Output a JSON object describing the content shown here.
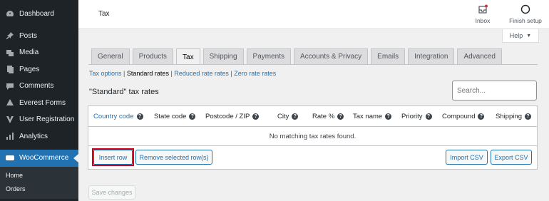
{
  "sidebar": {
    "items": [
      {
        "label": "Dashboard",
        "icon": "dashboard-icon"
      },
      {
        "label": "Posts",
        "icon": "pin-icon"
      },
      {
        "label": "Media",
        "icon": "media-icon"
      },
      {
        "label": "Pages",
        "icon": "pages-icon"
      },
      {
        "label": "Comments",
        "icon": "comment-icon"
      },
      {
        "label": "Everest Forms",
        "icon": "forms-icon"
      },
      {
        "label": "User Registration",
        "icon": "user-registration-icon"
      },
      {
        "label": "Analytics",
        "icon": "analytics-icon"
      }
    ],
    "active": {
      "label": "WooCommerce",
      "icon": "woocommerce-icon"
    },
    "submenu": [
      "Home",
      "Orders"
    ]
  },
  "header": {
    "title": "Tax",
    "inbox_label": "Inbox",
    "finish_label": "Finish setup",
    "help_label": "Help"
  },
  "tabs": [
    "General",
    "Products",
    "Tax",
    "Shipping",
    "Payments",
    "Accounts & Privacy",
    "Emails",
    "Integration",
    "Advanced"
  ],
  "active_tab": "Tax",
  "sublinks": {
    "tax_options": "Tax options",
    "standard_rates": "Standard rates",
    "reduced_rates": "Reduced rate rates",
    "zero_rates": "Zero rate rates"
  },
  "section_title": "\"Standard\" tax rates",
  "search": {
    "placeholder": "Search..."
  },
  "table": {
    "columns": [
      "Country code",
      "State code",
      "Postcode / ZIP",
      "City",
      "Rate %",
      "Tax name",
      "Priority",
      "Compound",
      "Shipping"
    ],
    "empty_message": "No matching tax rates found.",
    "insert_row": "Insert row",
    "remove_rows": "Remove selected row(s)",
    "import_csv": "Import CSV",
    "export_csv": "Export CSV"
  },
  "save_button": "Save changes",
  "colors": {
    "accent": "#2271b1",
    "highlight": "#d0021b",
    "sidebar": "#1d2327"
  }
}
